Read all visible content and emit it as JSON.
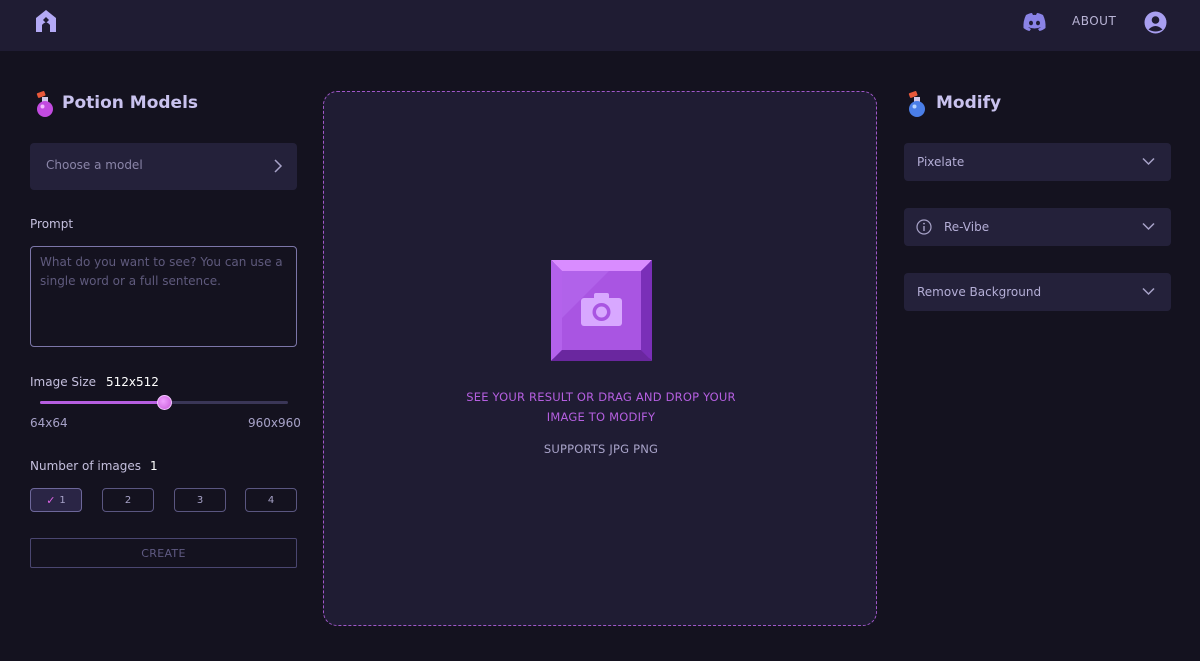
{
  "header": {
    "about_label": "ABOUT"
  },
  "icons": {
    "logo": "logo-icon",
    "discord": "discord-icon",
    "user": "user-account-icon",
    "potion_pink": "potion-icon",
    "potion_blue": "potion-icon"
  },
  "left_panel": {
    "title": "Potion Models",
    "model_select_placeholder": "Choose a model",
    "prompt_label": "Prompt",
    "prompt_placeholder": "What do you want to see? You can use a single word or a full sentence.",
    "image_size_label": "Image Size",
    "image_size_value": "512x512",
    "image_size_fraction": 0.5,
    "image_size_min": "64x64",
    "image_size_max": "960x960",
    "num_images_label": "Number of images",
    "num_images_value": "1",
    "num_options": [
      "1",
      "2",
      "3",
      "4"
    ],
    "create_label": "CREATE"
  },
  "center": {
    "drop_line1": "SEE YOUR RESULT OR DRAG AND DROP YOUR",
    "drop_line2": "IMAGE TO MODIFY",
    "supports": "SUPPORTS JPG PNG"
  },
  "right_panel": {
    "title": "Modify",
    "items": [
      {
        "label": "Pixelate"
      },
      {
        "label": "Re-Vibe"
      },
      {
        "label": "Remove Background"
      }
    ]
  },
  "colors": {
    "accent": "#b55fe0",
    "background": "#14121f",
    "panel": "#24213a"
  }
}
